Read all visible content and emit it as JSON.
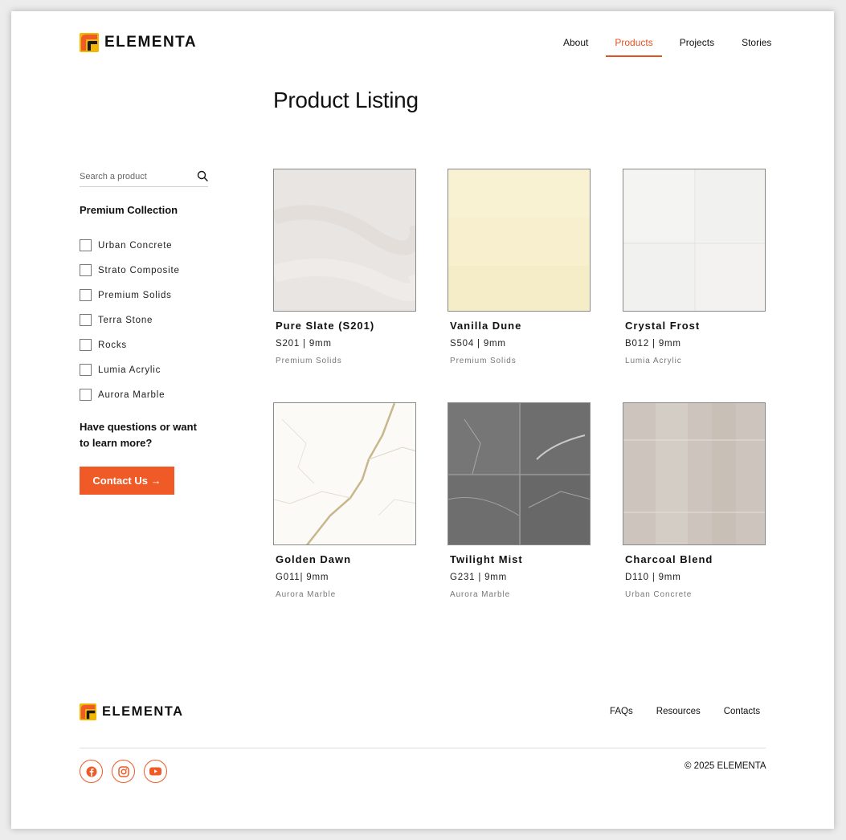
{
  "brand": {
    "name": "ELEMENTA",
    "accent": "#ef5a26",
    "active_nav": "#e4521f"
  },
  "nav": [
    {
      "label": "About"
    },
    {
      "label": "Products"
    },
    {
      "label": "Projects"
    },
    {
      "label": "Stories"
    }
  ],
  "page": {
    "title": "Product Listing"
  },
  "search": {
    "placeholder": "Search a product"
  },
  "sidebar": {
    "collection_title": "Premium Collection",
    "filters": [
      "Urban Concrete",
      "Strato Composite",
      "Premium Solids",
      "Terra Stone",
      "Rocks",
      "Lumia Acrylic",
      "Aurora Marble"
    ],
    "question": "Have questions or want to learn more?",
    "contact_label": "Contact Us →"
  },
  "products": [
    {
      "name": "Pure Slate (S201)",
      "code": "S201 | 9mm",
      "collection": "Premium Solids",
      "swatch": "#e9e5e2"
    },
    {
      "name": "Vanilla Dune",
      "code": "S504 | 9mm",
      "collection": "Premium Solids",
      "swatch": "#f7efcd"
    },
    {
      "name": "Crystal Frost",
      "code": "B012 | 9mm",
      "collection": "Lumia Acrylic",
      "swatch": "#f1f1ef"
    },
    {
      "name": "Golden Dawn",
      "code": "G011| 9mm",
      "collection": "Aurora Marble",
      "swatch": "#fbfaf7"
    },
    {
      "name": "Twilight Mist",
      "code": "G231 | 9mm",
      "collection": "Aurora Marble",
      "swatch": "#6e6e6e"
    },
    {
      "name": "Charcoal Blend",
      "code": "D110 | 9mm",
      "collection": "Urban Concrete",
      "swatch": "#cdc5bd"
    }
  ],
  "footer": {
    "links": [
      {
        "label": "FAQs"
      },
      {
        "label": "Resources"
      },
      {
        "label": "Contacts"
      }
    ],
    "socials": [
      "facebook-icon",
      "instagram-icon",
      "youtube-icon"
    ],
    "copyright": "© 2025 ELEMENTA"
  }
}
